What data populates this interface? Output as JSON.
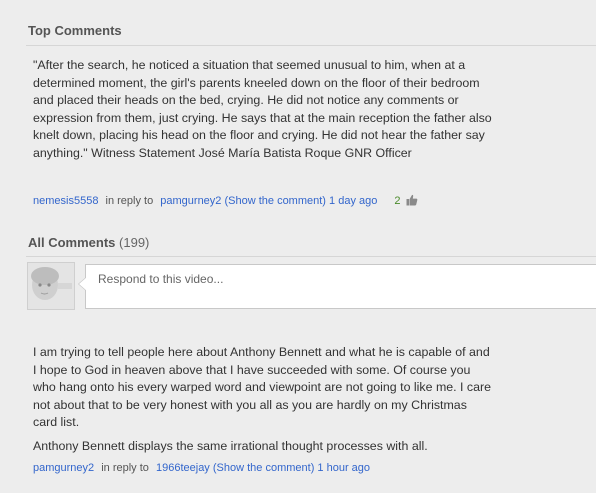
{
  "top_comments": {
    "heading": "Top Comments",
    "comment": {
      "text": "\"After the search, he noticed a situation that seemed unusual to him, when at a determined moment, the girl's parents kneeled down on the floor of their bedroom and placed their heads on the bed, crying. He did not notice any comments or expression from them, just crying. He says that at the main reception the father also knelt down, placing his head on the floor and crying. He did not hear the father say anything.\" Witness Statement José María Batista Roque GNR Officer",
      "author": "nemesis5558",
      "reply_prefix": "in reply to",
      "reply_to": "pamgurney2",
      "show_comment": "(Show the comment)",
      "time": "1 day ago",
      "likes": "2"
    }
  },
  "all_comments": {
    "heading": "All Comments",
    "count": "(199)",
    "reply_placeholder": "Respond to this video...",
    "comment": {
      "paragraph1": "I am trying to tell people here about Anthony Bennett and what he is capable of and I hope to God in heaven above that I have succeeded with some. Of course you who hang onto his every warped word and viewpoint are not going to like me. I care not about that to be very honest with you all as you are hardly on my Christmas card list.",
      "paragraph2": "Anthony Bennett displays the same irrational thought processes with all.",
      "author": "pamgurney2",
      "reply_prefix": "in reply to",
      "reply_to": "1966teejay",
      "show_comment": "(Show the comment)",
      "time": "1 hour ago"
    }
  }
}
